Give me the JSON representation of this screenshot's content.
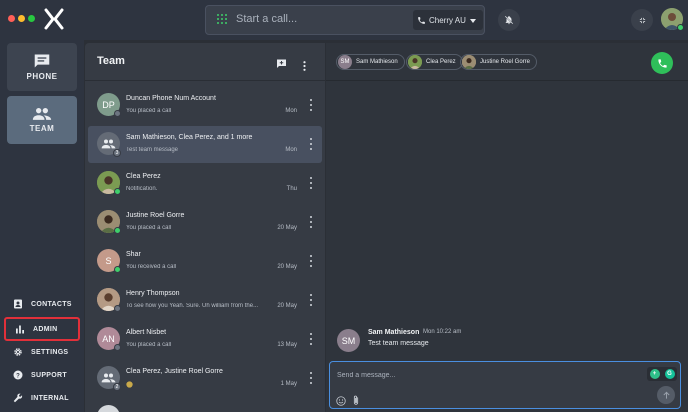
{
  "topbar": {
    "call_placeholder": "Start a call...",
    "line_name": "Cherry AU",
    "traffic_colors": [
      "#ff5f57",
      "#febc2e",
      "#28c840"
    ]
  },
  "nav": {
    "tiles": [
      {
        "label": "PHONE",
        "icon": "message-icon"
      },
      {
        "label": "TEAM",
        "icon": "people-icon"
      }
    ],
    "links": [
      {
        "label": "CONTACTS",
        "icon": "contacts-icon"
      },
      {
        "label": "ADMIN",
        "icon": "bar-chart-icon"
      },
      {
        "label": "SETTINGS",
        "icon": "gear-icon"
      },
      {
        "label": "SUPPORT",
        "icon": "help-icon"
      },
      {
        "label": "INTERNAL",
        "icon": "wrench-icon"
      }
    ]
  },
  "list": {
    "title": "Team",
    "rows": [
      {
        "initials": "DP",
        "name": "Duncan Phone Num Account",
        "sub": "You placed a call",
        "time": "Mon"
      },
      {
        "initials": "",
        "name": "Sam Mathieson, Clea Perez, and 1 more",
        "sub": "Test team message",
        "time": "Mon",
        "badge": "3"
      },
      {
        "initials": "",
        "name": "Clea Perez",
        "sub": "Notification.",
        "time": "Thu"
      },
      {
        "initials": "",
        "name": "Justine Roel Gorre",
        "sub": "You placed a call",
        "time": "20 May"
      },
      {
        "initials": "S",
        "name": "Shar",
        "sub": "You received a call",
        "time": "20 May"
      },
      {
        "initials": "",
        "name": "Henry Thompson",
        "sub": "To see how you Yeah. Sure. Uh william from the...",
        "time": "20 May"
      },
      {
        "initials": "AN",
        "name": "Albert Nisbet",
        "sub": "You placed a call",
        "time": "13 May"
      },
      {
        "initials": "",
        "name": "Clea Perez, Justine Roel Gorre",
        "sub": "",
        "time": "1 May",
        "badge": "2"
      }
    ]
  },
  "chat": {
    "participants": [
      {
        "initials": "SM",
        "name": "Sam Mathieson"
      },
      {
        "initials": "",
        "name": "Clea Perez"
      },
      {
        "initials": "",
        "name": "Justine Roel Gorre"
      }
    ],
    "message": {
      "initials": "SM",
      "sender": "Sam Mathieson",
      "time": "Mon 10:22 am",
      "text": "Test team message"
    },
    "composer_placeholder": "Send a message..."
  },
  "colors": {
    "accent_green": "#2fbf5a",
    "online": "#3ecf6b",
    "composer_border": "#4a8fe0",
    "highlight_red": "#e2303a"
  }
}
